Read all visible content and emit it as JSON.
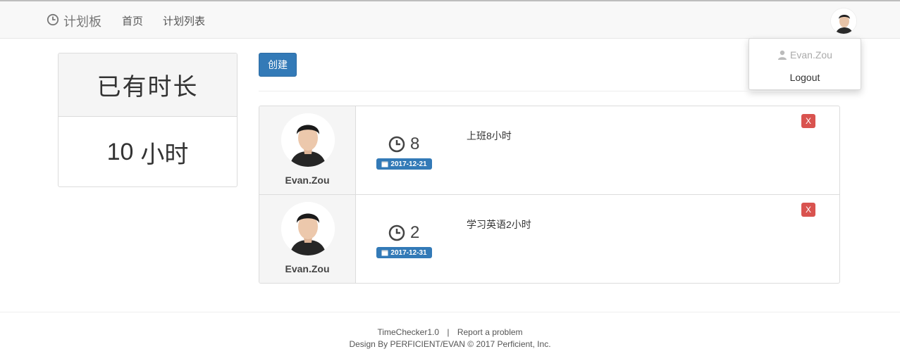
{
  "navbar": {
    "brand_icon": "clock-icon",
    "brand": "计划板",
    "links": [
      {
        "label": "首页"
      },
      {
        "label": "计划列表"
      }
    ],
    "avatar_icon": "avatar"
  },
  "user_menu": {
    "user_icon": "user-icon",
    "username": "Evan.Zou",
    "logout": "Logout"
  },
  "stats": {
    "title": "已有时长",
    "value": "10",
    "unit": "小时"
  },
  "actions": {
    "create": "创建"
  },
  "entries": [
    {
      "user": "Evan.Zou",
      "hours": "8",
      "date": "2017-12-21",
      "text": "上班8小时",
      "delete": "X"
    },
    {
      "user": "Evan.Zou",
      "hours": "2",
      "date": "2017-12-31",
      "text": "学习英语2小时",
      "delete": "X"
    }
  ],
  "footer": {
    "version": "TimeChecker1.0",
    "separator": "|",
    "report": "Report a problem",
    "credit": "Design By PERFICIENT/EVAN © 2017 Perficient, Inc."
  },
  "colors": {
    "primary": "#337ab7",
    "danger": "#d9534f",
    "panel_bg": "#f5f5f5",
    "navbar_bg": "#f8f8f8"
  }
}
